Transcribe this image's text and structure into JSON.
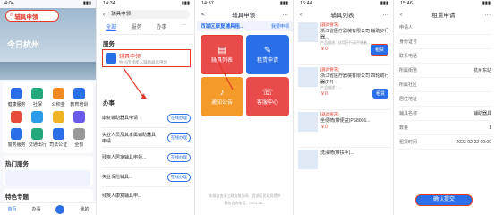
{
  "p1": {
    "status_time": "4:04",
    "search_text": "辅具申领",
    "banner": "今日杭州",
    "grid": [
      {
        "label": "健康服务",
        "color": "#2a6fe8"
      },
      {
        "label": "社保",
        "color": "#24a77a"
      },
      {
        "label": "公积金",
        "color": "#f08a24"
      },
      {
        "label": "教育培训",
        "color": "#2a6fe8"
      },
      {
        "label": "",
        "color": "#e84a3a"
      },
      {
        "label": "",
        "color": "#2a9be8"
      },
      {
        "label": "",
        "color": "#f0b324"
      },
      {
        "label": "",
        "color": "#6a5ae8"
      },
      {
        "label": "警务服务",
        "color": "#2a6fe8"
      },
      {
        "label": "交通出行",
        "color": "#24a77a"
      },
      {
        "label": "司法公证",
        "color": "#2a6fe8"
      },
      {
        "label": "全部",
        "color": "#999999"
      }
    ],
    "hot_title": "热门服务",
    "special_title": "特色专题",
    "tabs": [
      "首页",
      "办事",
      "",
      "我的"
    ]
  },
  "p2": {
    "status_time": "14:34",
    "search_text": "辅具申领",
    "tabs": [
      "全部",
      "服务",
      "办事",
      "",
      ""
    ],
    "section_service": "服务",
    "svc_title": "辅具申领",
    "svc_sub": "杭州市残疾人辅助器具申领",
    "section_matter": "办事",
    "items": [
      {
        "name": "康复辅助器具申请",
        "button": "在线办理"
      },
      {
        "name": "失业人员及其家属辅助器具申请",
        "button": "在线办理"
      },
      {
        "name": "残疾人居家辅具申领...",
        "button": "在线办理"
      },
      {
        "name": "失业保险辅具...",
        "button": "在线办理"
      },
      {
        "name": "残疾人康复辅具申...",
        "button": ""
      }
    ]
  },
  "p3": {
    "status_time": "14:37",
    "back_label": "<",
    "title": "辅具申领",
    "header_left": "西湖区康复辅具租...",
    "header_right": "我要申领",
    "tiles": [
      {
        "label": "辅具列表",
        "color": "#e94b4b"
      },
      {
        "label": "租赁申请",
        "color": "#2a6fe8"
      },
      {
        "label": "通知公告",
        "color": "#f39a2a"
      },
      {
        "label": "客服中心",
        "color": "#e94b4b"
      }
    ],
    "footer1": "本服务由浙江政务服务网、西湖区民政局提供",
    "footer2": "服务咨询电话：0571-88..."
  },
  "p4": {
    "status_time": "15:44",
    "title": "辅具列表",
    "products": [
      {
        "tag": "[器具要求]",
        "name": "浙江省医疗器械有限公司 辅助步行器...",
        "desc": "产品描述：适用于行动不便者...",
        "price": "￥0",
        "button": "租赁"
      },
      {
        "tag": "[器具要求]",
        "name": "浙江省医疗器械有限公司 四轮助行器(P4)",
        "desc": "产品描述：...",
        "price": "￥0",
        "button": "租赁"
      },
      {
        "tag": "[器具要求]",
        "name": "坐便椅(带便盆)PS8006...",
        "desc": "",
        "price": "￥0",
        "button": ""
      },
      {
        "tag": "",
        "name": "洗澡椅(带扶手)...",
        "desc": "",
        "price": "",
        "button": ""
      }
    ]
  },
  "p5": {
    "status_time": "15:46",
    "title": "租赁申请",
    "fields": [
      {
        "label": "申请人",
        "value": ""
      },
      {
        "label": "身份证号",
        "value": ""
      },
      {
        "label": "联系电话",
        "value": ""
      },
      {
        "label": "所属街道",
        "value": "杭州东站"
      },
      {
        "label": "所属社区",
        "value": ""
      },
      {
        "label": "居住地址",
        "value": ""
      },
      {
        "label": "辅具名称",
        "value": "辅助器具"
      },
      {
        "label": "数量",
        "value": "1"
      },
      {
        "label": "租赁时间",
        "value": "2023-02-22 00:00"
      }
    ],
    "submit": "确认提交"
  }
}
